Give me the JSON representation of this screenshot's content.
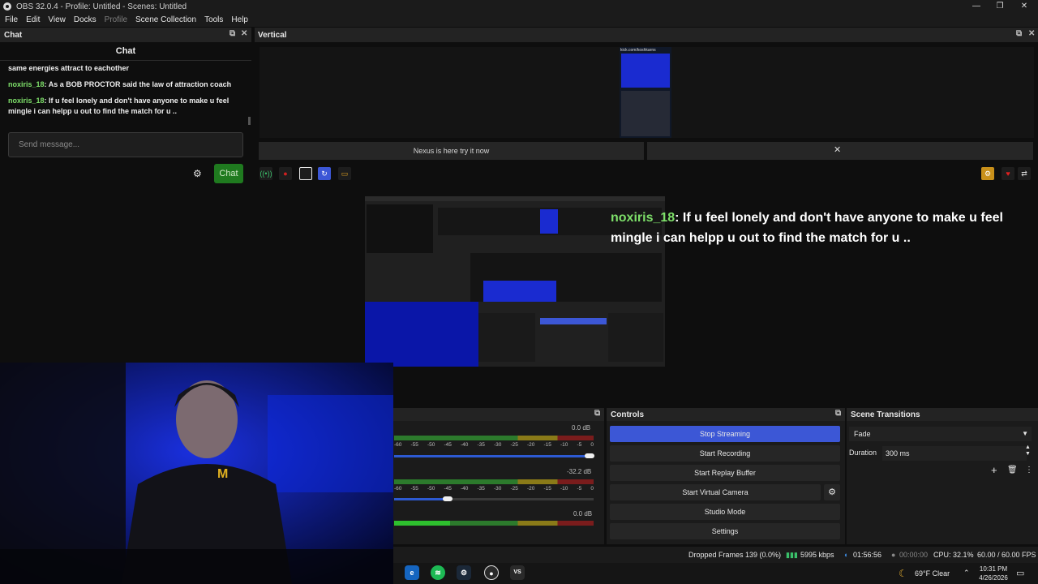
{
  "window": {
    "title": "OBS 32.0.4 - Profile: Untitled - Scenes: Untitled",
    "controls": [
      "—",
      "❐",
      "✕"
    ]
  },
  "menu": [
    "File",
    "Edit",
    "View",
    "Docks",
    "Profile",
    "Scene Collection",
    "Tools",
    "Help"
  ],
  "chat": {
    "dock_title": "Chat",
    "header": "Chat",
    "messages": [
      {
        "user": "",
        "text": "same energies attract to eachother"
      },
      {
        "user": "noxiris_18",
        "text": ": As a BOB PROCTOR said the law of attraction coach"
      },
      {
        "user": "noxiris_18",
        "text": ": If u feel lonely and don't have anyone to make u feel mingle i can helpp u out to find the match for u .."
      }
    ],
    "placeholder": "Send message...",
    "send_label": "Chat"
  },
  "vertical": {
    "dock_title": "Vertical",
    "preview_url": "kick.com/koshkarns",
    "nexus_text": "Nexus is here try it now",
    "close_glyph": "✕"
  },
  "overlay": {
    "user": "noxiris_18",
    "text": ": If u feel lonely and don't have anyone to make u feel mingle i can helpp u out to find the match for u .."
  },
  "mixer": {
    "channels": [
      {
        "db": "0.0 dB",
        "fader": 0.98
      },
      {
        "db": "-32.2 dB",
        "fader": 0.27
      },
      {
        "db": "0.0 dB",
        "fader": null
      }
    ],
    "ticks": [
      "-60",
      "-55",
      "-50",
      "-45",
      "-40",
      "-35",
      "-30",
      "-25",
      "-20",
      "-15",
      "-10",
      "-5",
      "0"
    ]
  },
  "controls": {
    "title": "Controls",
    "buttons": [
      "Stop Streaming",
      "Start Recording",
      "Start Replay Buffer",
      "Start Virtual Camera",
      "Studio Mode",
      "Settings"
    ]
  },
  "transitions": {
    "title": "Scene Transitions",
    "selected": "Fade",
    "duration_label": "Duration",
    "duration_value": "300 ms"
  },
  "status": {
    "dropped": "Dropped Frames 139 (0.0%)",
    "bitrate": "5995 kbps",
    "stream_time": "01:56:56",
    "rec_time": "00:00:00",
    "cpu": "CPU: 32.1%",
    "fps": "60.00 / 60.00 FPS"
  },
  "tray": {
    "weather": "69°F  Clear",
    "time": "10:31 PM",
    "date": "4/26/2026"
  },
  "colors": {
    "accent": "#3c57d6",
    "chat_user": "#7ee06a",
    "chat_button": "#1f7a1f"
  }
}
